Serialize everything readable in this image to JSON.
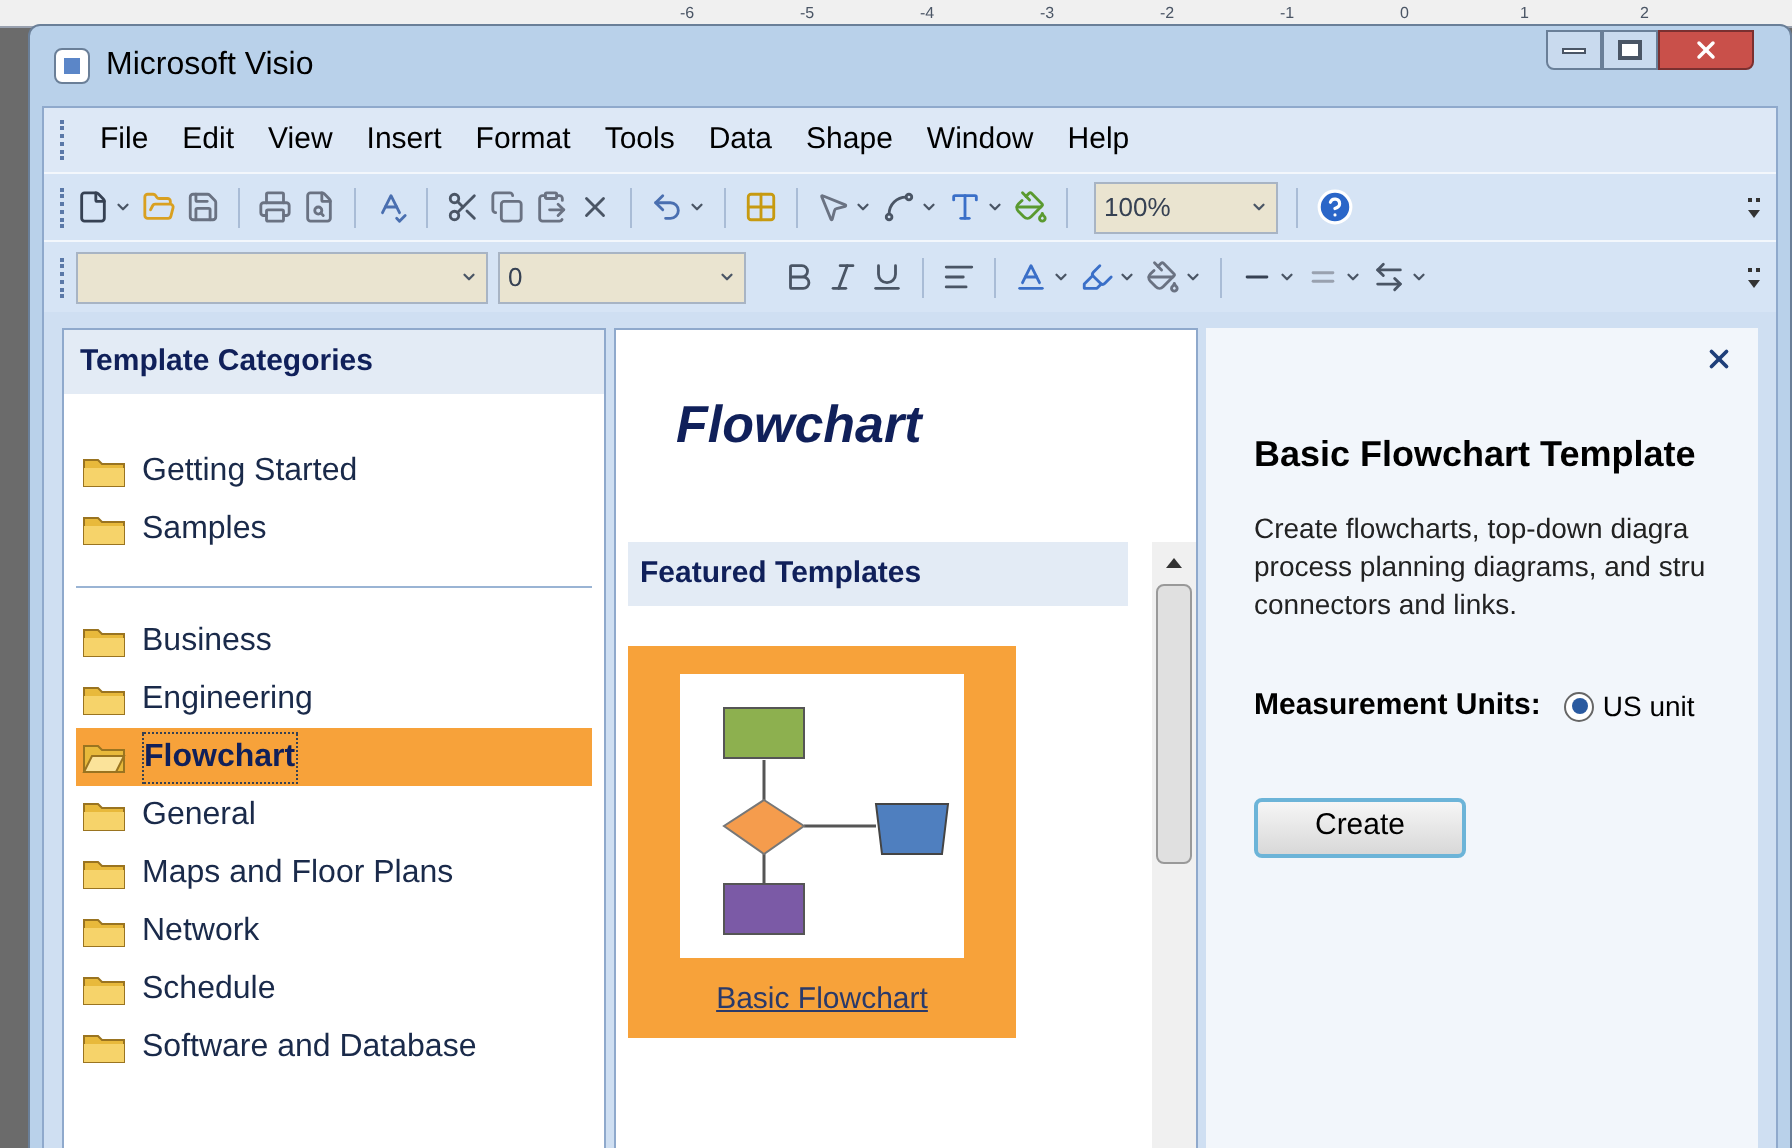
{
  "ruler": {
    "ticks": [
      "-6",
      "-5",
      "-4",
      "-3",
      "-2",
      "-1",
      "0",
      "1",
      "2"
    ]
  },
  "window": {
    "title": "Microsoft Visio"
  },
  "menu": [
    "File",
    "Edit",
    "View",
    "Insert",
    "Format",
    "Tools",
    "Data",
    "Shape",
    "Window",
    "Help"
  ],
  "toolbar_standard": {
    "zoom": "100%"
  },
  "toolbar_formatting": {
    "font_size": "0"
  },
  "categories": {
    "title": "Template Categories",
    "groups": [
      {
        "items": [
          {
            "label": "Getting Started",
            "selected": false
          },
          {
            "label": "Samples",
            "selected": false
          }
        ]
      },
      {
        "items": [
          {
            "label": "Business",
            "selected": false
          },
          {
            "label": "Engineering",
            "selected": false
          },
          {
            "label": "Flowchart",
            "selected": true
          },
          {
            "label": "General",
            "selected": false
          },
          {
            "label": "Maps and Floor Plans",
            "selected": false
          },
          {
            "label": "Network",
            "selected": false
          },
          {
            "label": "Schedule",
            "selected": false
          },
          {
            "label": "Software and Database",
            "selected": false
          }
        ]
      }
    ]
  },
  "gallery": {
    "title": "Flowchart",
    "section": "Featured Templates",
    "templates": [
      {
        "label": "Basic Flowchart",
        "selected": true
      }
    ]
  },
  "details": {
    "title": "Basic Flowchart Template",
    "description": [
      "Create flowcharts, top-down diagra",
      "process planning diagrams, and stru",
      "connectors and links."
    ],
    "units_label": "Measurement Units:",
    "units_option": {
      "label": "US unit",
      "selected": true
    },
    "button": "Create"
  }
}
